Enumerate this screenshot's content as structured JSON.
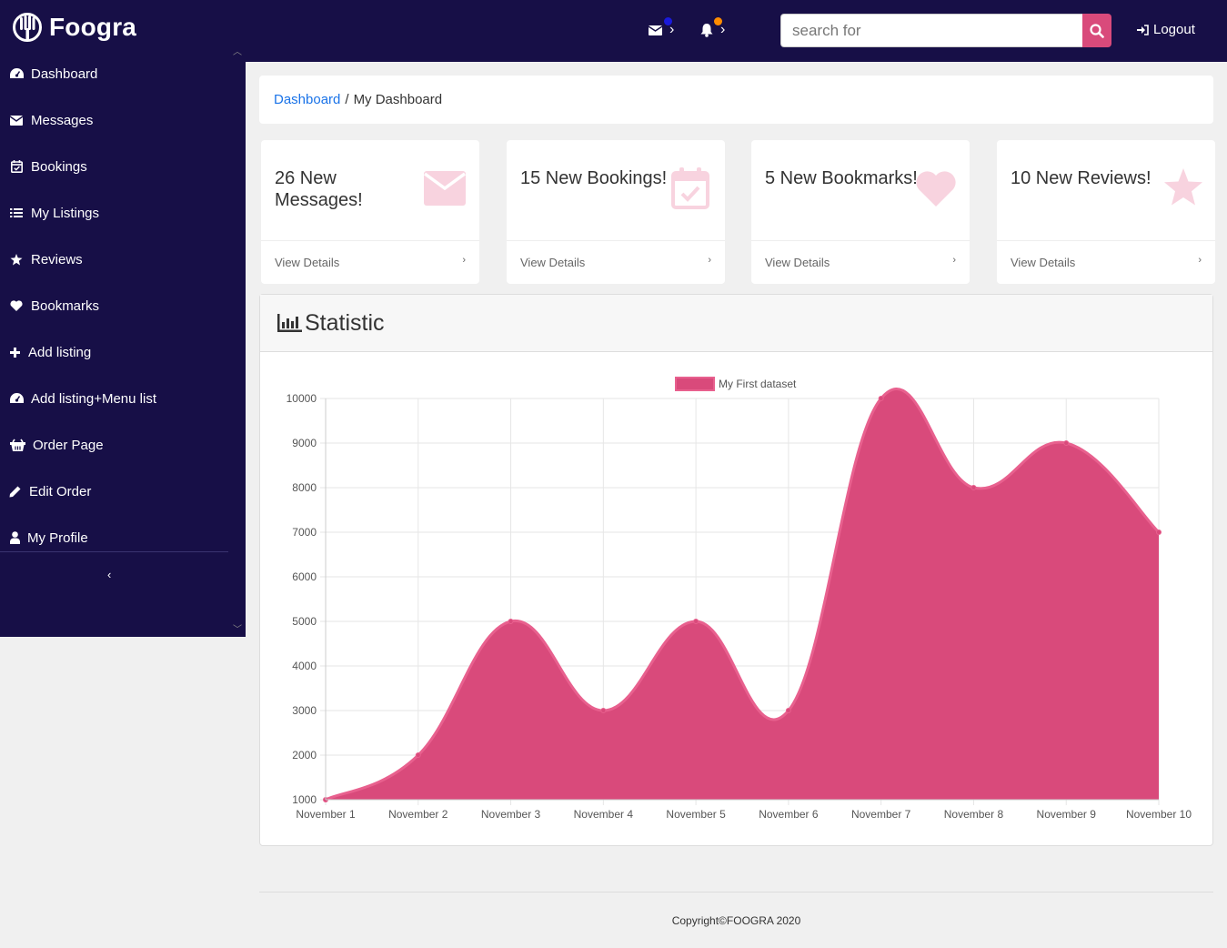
{
  "brand": {
    "name": "Foogra"
  },
  "header": {
    "search_placeholder": "search for",
    "logout_label": "Logout",
    "colors": {
      "bg": "#170f47",
      "accent": "#d94a7b",
      "message_dot": "#1a1adb",
      "alert_dot": "#ff8c00"
    }
  },
  "sidebar": {
    "items": [
      {
        "label": "Dashboard",
        "icon": "dashboard-icon"
      },
      {
        "label": "Messages",
        "icon": "envelope-icon"
      },
      {
        "label": "Bookings",
        "icon": "calendar-check-icon"
      },
      {
        "label": "My Listings",
        "icon": "list-icon"
      },
      {
        "label": "Reviews",
        "icon": "star-icon"
      },
      {
        "label": "Bookmarks",
        "icon": "heart-icon"
      },
      {
        "label": "Add listing",
        "icon": "plus-icon"
      },
      {
        "label": "Add listing+Menu list",
        "icon": "dashboard-icon"
      },
      {
        "label": "Order Page",
        "icon": "basket-icon"
      },
      {
        "label": "Edit Order",
        "icon": "pencil-icon"
      },
      {
        "label": "My Profile",
        "icon": "user-icon"
      }
    ]
  },
  "breadcrumb": {
    "link": "Dashboard",
    "separator": "/",
    "current": "My Dashboard"
  },
  "cards": [
    {
      "title": "26 New Messages!",
      "footer": "View Details",
      "icon": "envelope-icon"
    },
    {
      "title": "15 New Bookings!",
      "footer": "View Details",
      "icon": "calendar-check-icon"
    },
    {
      "title": "5 New Bookmarks!",
      "footer": "View Details",
      "icon": "heart-icon"
    },
    {
      "title": "10 New Reviews!",
      "footer": "View Details",
      "icon": "star-icon"
    }
  ],
  "statistic": {
    "title": "Statistic",
    "icon": "bar-chart-icon"
  },
  "chart_data": {
    "type": "area",
    "categories": [
      "November 1",
      "November 2",
      "November 3",
      "November 4",
      "November 5",
      "November 6",
      "November 7",
      "November 8",
      "November 9",
      "November 10"
    ],
    "series": [
      {
        "name": "My First dataset",
        "values": [
          1000,
          2000,
          5000,
          3000,
          5000,
          3000,
          10000,
          8000,
          9000,
          7000
        ],
        "color": "#d94a7b"
      }
    ],
    "ylim": [
      1000,
      10000
    ],
    "yticks": [
      1000,
      2000,
      3000,
      4000,
      5000,
      6000,
      7000,
      8000,
      9000,
      10000
    ],
    "grid": true,
    "legend": "top-center"
  },
  "footer": {
    "copyright": "Copyright©FOOGRA 2020"
  }
}
